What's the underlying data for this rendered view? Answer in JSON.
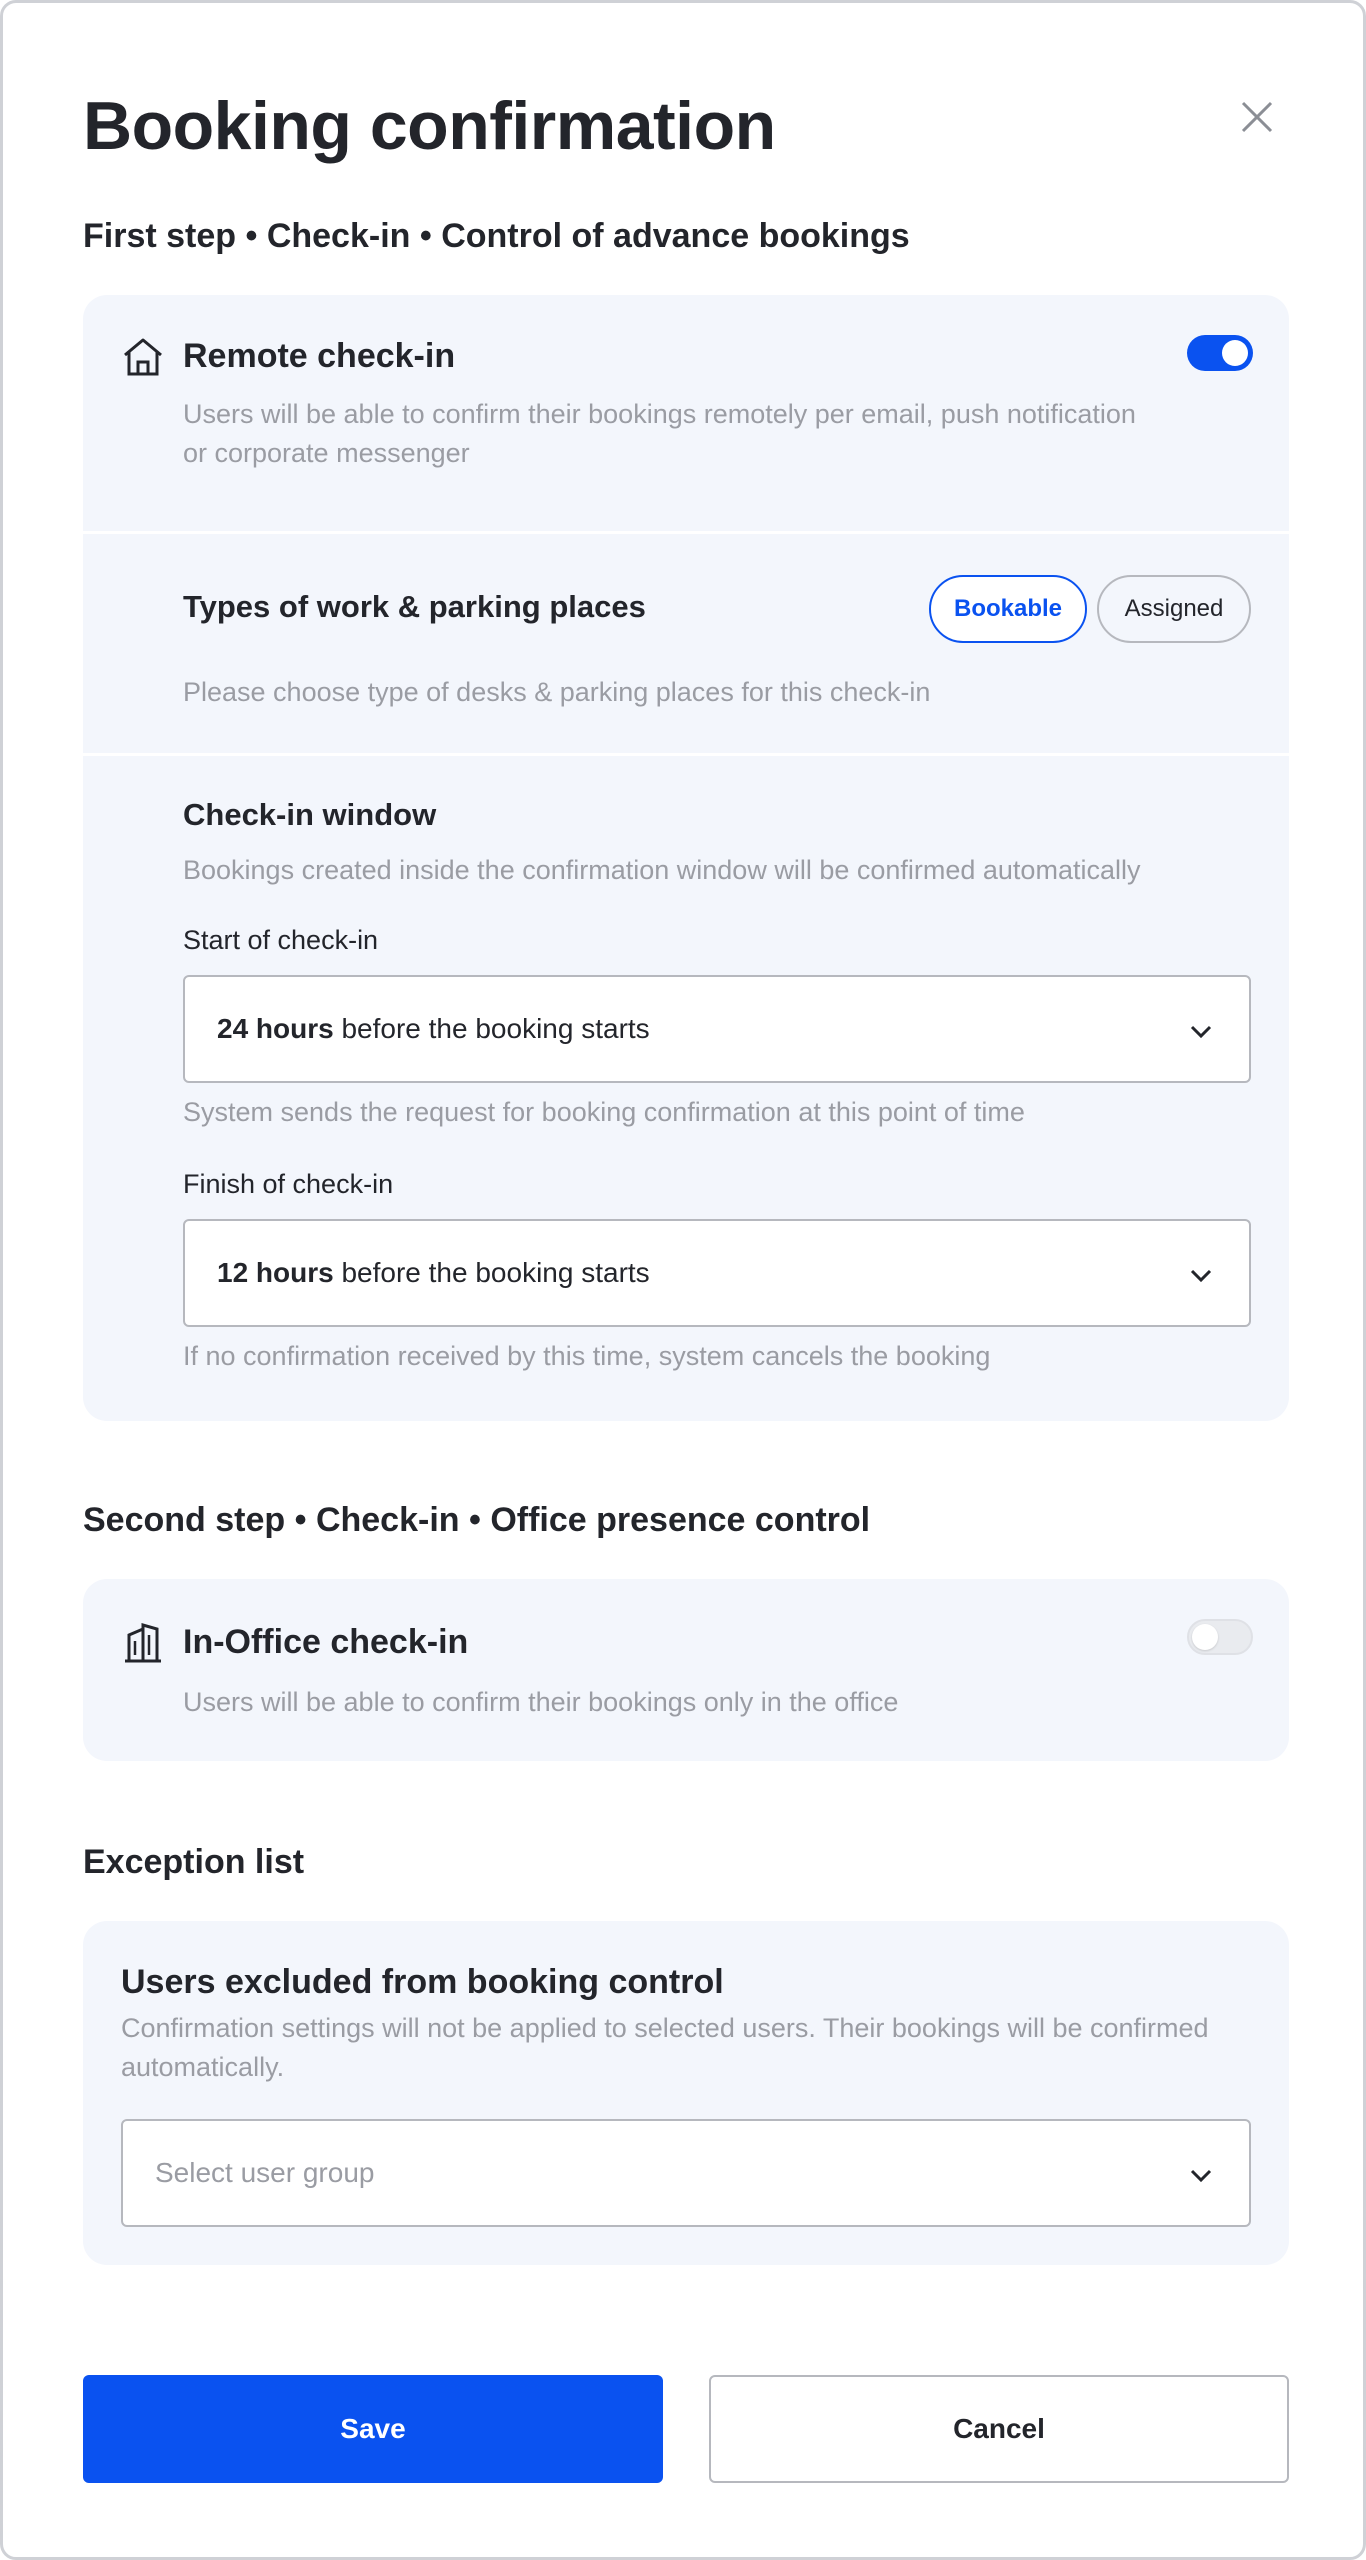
{
  "dialog": {
    "title": "Booking confirmation"
  },
  "first_step": {
    "title": "First step • Check-in • Control of advance bookings",
    "remote": {
      "title": "Remote check-in",
      "description": "Users will be able to confirm their bookings remotely per email, push notification or corporate messenger",
      "enabled": true,
      "icon": "house-icon"
    },
    "types": {
      "title": "Types of work & parking places",
      "description": "Please choose type of desks & parking places for this check-in",
      "options": [
        "Bookable",
        "Assigned"
      ],
      "selected": "Bookable"
    },
    "window": {
      "title": "Check-in window",
      "description": "Bookings created inside the confirmation window will be confirmed automatically",
      "start": {
        "label": "Start of check-in",
        "value_bold": "24 hours",
        "value_rest": " before the booking starts",
        "hint": "System sends the request for booking confirmation at this point of time"
      },
      "finish": {
        "label": "Finish of check-in",
        "value_bold": "12 hours",
        "value_rest": " before the booking starts",
        "hint": "If no confirmation received by this time, system cancels the booking"
      }
    }
  },
  "second_step": {
    "title": "Second step • Check-in • Office presence control",
    "office": {
      "title": "In-Office check-in",
      "description": "Users will be able to confirm their bookings only in the office",
      "enabled": false,
      "icon": "office-building-icon"
    }
  },
  "exceptions": {
    "title": "Exception list",
    "card_title": "Users excluded from booking control",
    "card_description": "Confirmation settings will not be applied to selected users. Their bookings will be confirmed automatically.",
    "select_placeholder": "Select user group"
  },
  "actions": {
    "save": "Save",
    "cancel": "Cancel"
  },
  "colors": {
    "accent": "#0a52f0",
    "card_bg": "#f3f6fc",
    "muted_text": "#9a9ca3"
  }
}
